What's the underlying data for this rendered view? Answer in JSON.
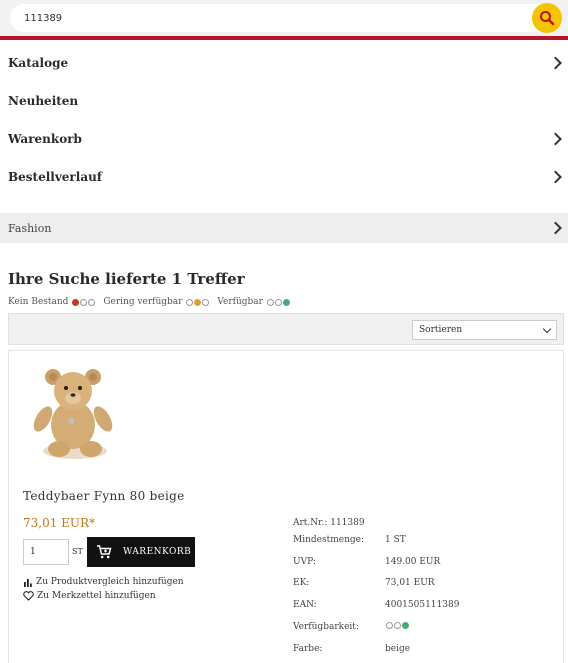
{
  "search": {
    "value": "111389"
  },
  "nav": {
    "items": [
      {
        "label": "Kataloge"
      },
      {
        "label": "Neuheiten"
      },
      {
        "label": "Warenkorb"
      },
      {
        "label": "Bestellverlauf"
      }
    ],
    "fashion": "Fashion"
  },
  "results": {
    "heading": "Ihre Suche lieferte 1 Treffer",
    "legend": {
      "none": "Kein Bestand",
      "low": "Gering verfügbar",
      "available": "Verfügbar"
    },
    "sort_label": "Sortieren"
  },
  "product": {
    "name": "Teddybaer Fynn 80 beige",
    "price": "73,01 EUR*",
    "quantity": "1",
    "unit": "ST",
    "cart_button": "WARENKORB",
    "compare_link": "Zu Produktvergleich hinzufügen",
    "wishlist_link": "Zu Merkzettel hinzufügen",
    "specs": {
      "art_nr": "Art.Nr.: 111389",
      "min_label": "Mindestmenge:",
      "min_value": "1 ST",
      "uvp_label": "UVP:",
      "uvp_value": "149.00 EUR",
      "ek_label": "EK:",
      "ek_value": "73,01 EUR",
      "ean_label": "EAN:",
      "ean_value": "4001505111389",
      "avail_label": "Verfügbarkeit:",
      "color_label": "Farbe:",
      "color_value": "beige"
    }
  },
  "colors": {
    "accent_red": "#b5162e",
    "search_button": "#f5c400",
    "price": "#c2791a",
    "available_green": "#4aa878"
  }
}
